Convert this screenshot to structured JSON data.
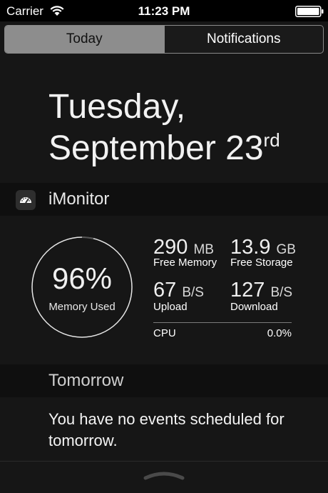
{
  "status_bar": {
    "carrier": "Carrier",
    "time": "11:23 PM"
  },
  "segmented_control": {
    "tabs": [
      {
        "label": "Today",
        "selected": true
      },
      {
        "label": "Notifications",
        "selected": false
      }
    ]
  },
  "date": {
    "weekday": "Tuesday,",
    "month_day": "September 23",
    "suffix": "rd"
  },
  "imonitor": {
    "title": "iMonitor",
    "memory_used": {
      "percent": "96%",
      "label": "Memory Used"
    },
    "stats": [
      {
        "value": "290",
        "unit": "MB",
        "label": "Free Memory"
      },
      {
        "value": "13.9",
        "unit": "GB",
        "label": "Free Storage"
      },
      {
        "value": "67",
        "unit": "B/S",
        "label": "Upload"
      },
      {
        "value": "127",
        "unit": "B/S",
        "label": "Download"
      }
    ],
    "cpu": {
      "label": "CPU",
      "value": "0.0%"
    }
  },
  "tomorrow": {
    "title": "Tomorrow",
    "message": "You have no events scheduled for tomorrow."
  },
  "colors": {
    "background": "#161616",
    "segment_selected": "#8d8d8d",
    "header_band": "#0f0f0f"
  }
}
